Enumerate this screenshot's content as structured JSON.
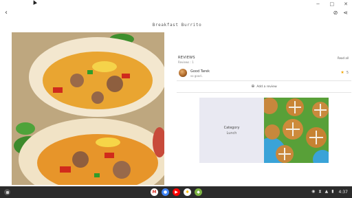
{
  "window": {
    "minimize_glyph": "−",
    "maximize_glyph": "□",
    "close_glyph": "✕"
  },
  "appbar": {
    "back_glyph": "‹",
    "hide_icon_glyph": "⊘",
    "share_icon_glyph": "⋖"
  },
  "recipe": {
    "title": "Breakfast Burrito"
  },
  "reviews": {
    "title": "REVIEWS",
    "count": "Reviews : 1",
    "read_all": "Read all",
    "items": [
      {
        "name": "Good Tarek",
        "text": "so good..",
        "rating": "5"
      }
    ],
    "add_review_label": "Add a review",
    "add_review_glyph": "⊕"
  },
  "category": {
    "label": "Category",
    "value": "Lunch"
  },
  "colors": {
    "star": "#f2a600",
    "shelf": "#2b2b2b",
    "category_card": "#e9e9f2"
  },
  "shelf": {
    "apps": [
      {
        "name": "gmail",
        "glyph": "M",
        "color": "#ffffff",
        "fg": "#d93025"
      },
      {
        "name": "chrome",
        "glyph": "●",
        "color": "#4285f4",
        "fg": "#ffffff"
      },
      {
        "name": "youtube",
        "glyph": "▶",
        "color": "#ff0000",
        "fg": "#ffffff"
      },
      {
        "name": "photos",
        "glyph": "✱",
        "color": "#ffffff",
        "fg": "#fbbc04"
      },
      {
        "name": "android-app",
        "glyph": "◆",
        "color": "#7cb342",
        "fg": "#ffffff"
      }
    ],
    "time": "4:37",
    "tray_icons": [
      "◉",
      "⧗",
      "▲",
      "▮"
    ]
  }
}
